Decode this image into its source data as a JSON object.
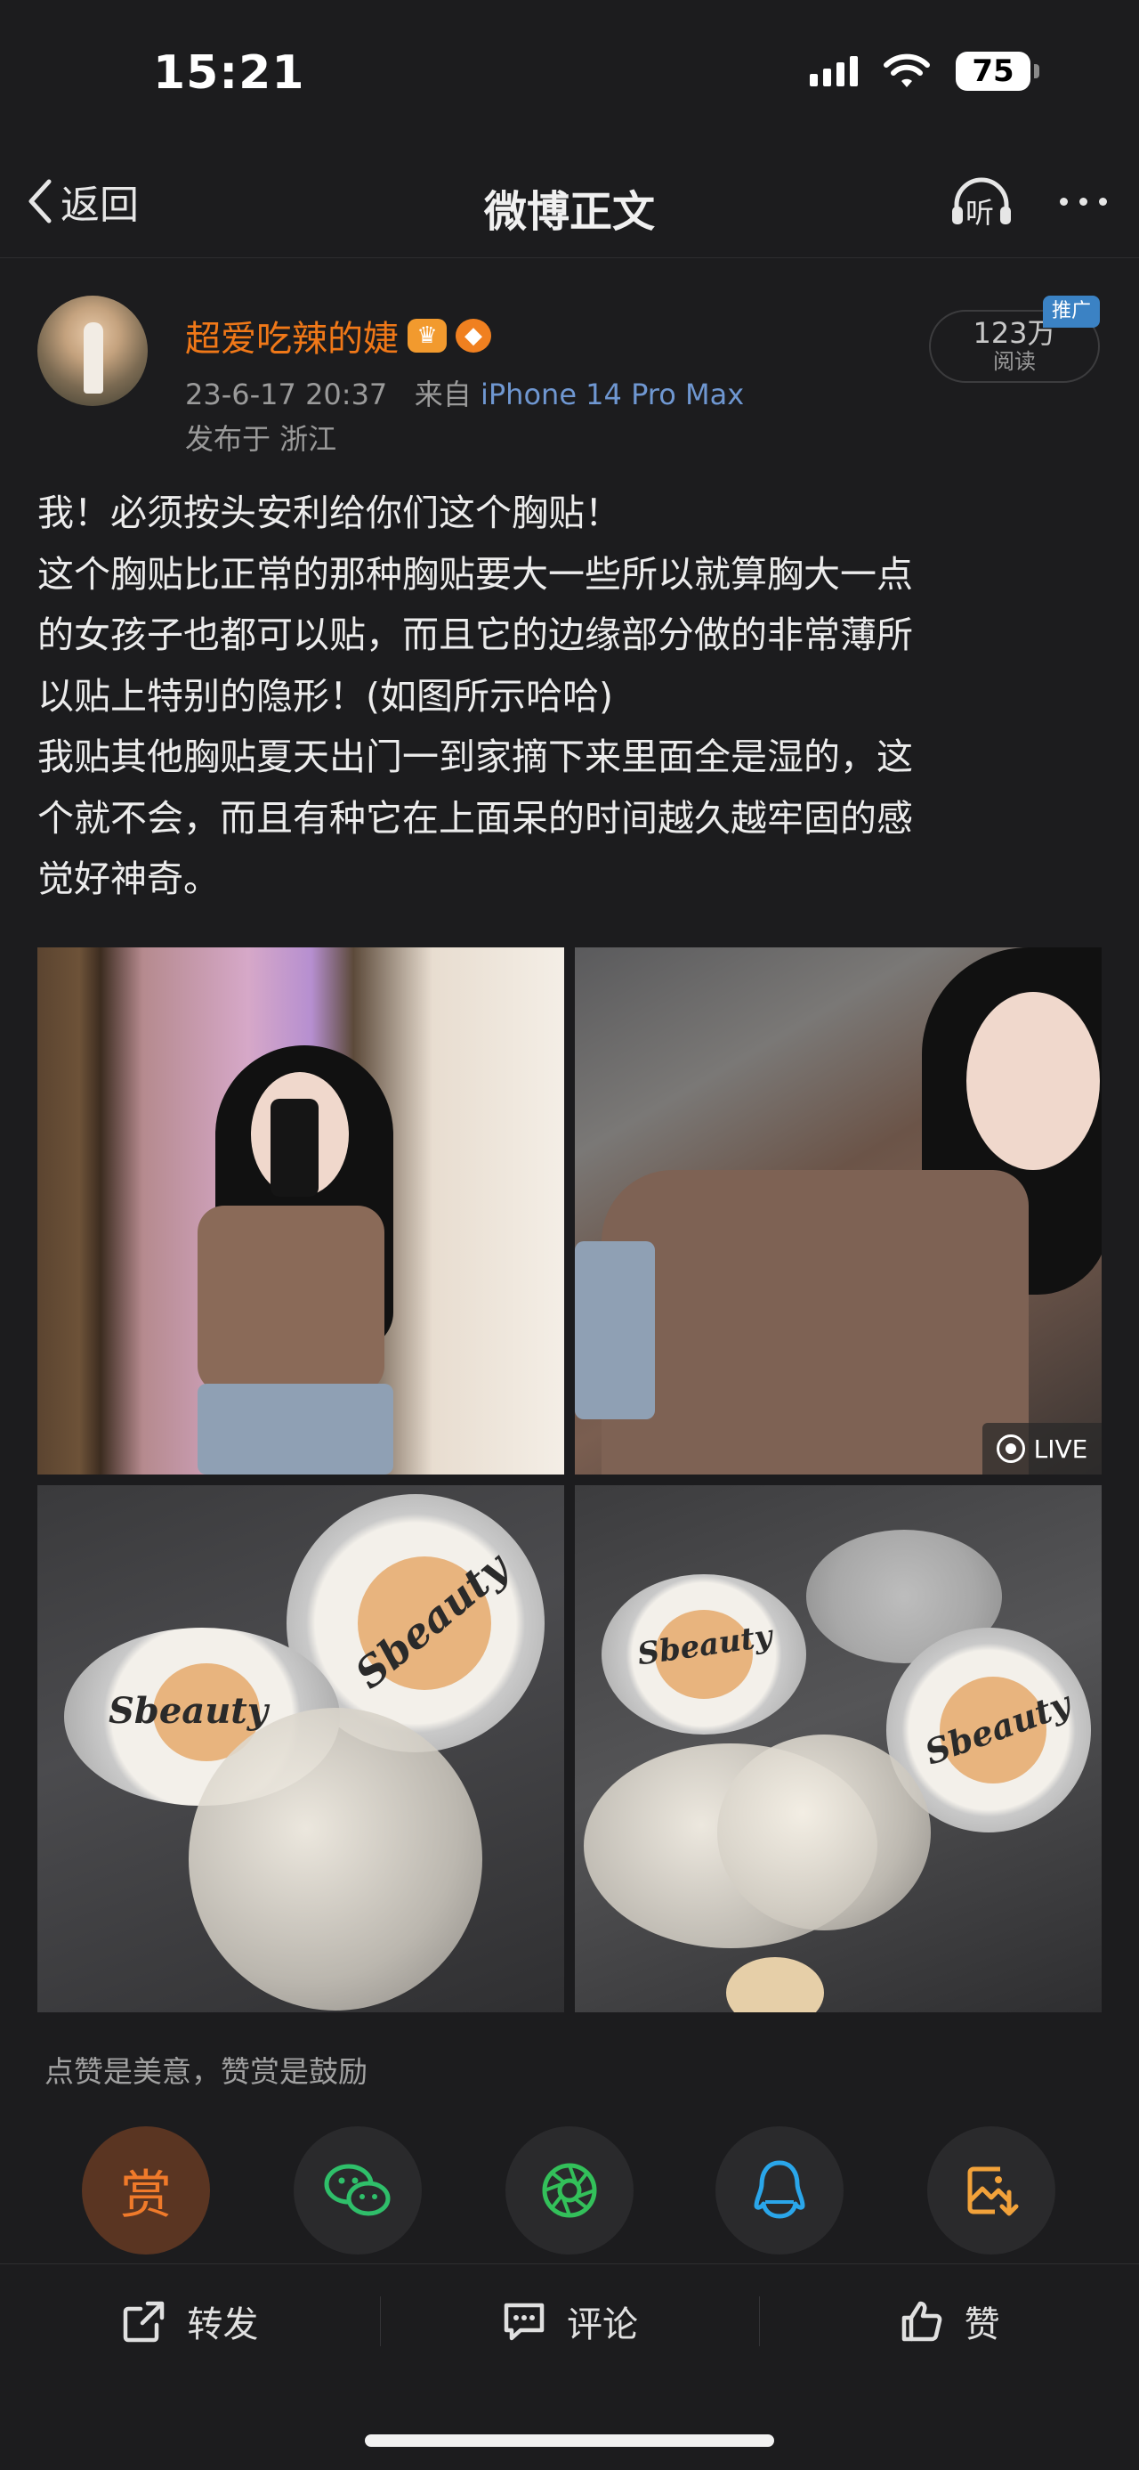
{
  "status_bar": {
    "time": "15:21",
    "battery": "75"
  },
  "nav": {
    "back_label": "返回",
    "title": "微博正文",
    "listen_label": "听"
  },
  "post": {
    "author": "超爱吃辣的婕",
    "date": "23-6-17 20:37",
    "source_prefix": "来自",
    "device": "iPhone 14 Pro Max",
    "location": "发布于 浙江",
    "read_count": "123万",
    "read_label": "阅读",
    "promo_label": "推广",
    "text_lines": [
      "我！必须按头安利给你们这个胸贴！",
      "这个胸贴比正常的那种胸贴要大一些所以就算胸大一点",
      "的女孩子也都可以贴，而且它的边缘部分做的非常薄所",
      "以贴上特别的隐形！(如图所示哈哈)",
      "我贴其他胸贴夏天出门一到家摘下来里面全是湿的，这",
      "个就不会，而且有种它在上面呆的时间越久越牢固的感",
      "觉好神奇。"
    ],
    "images": [
      {
        "name": "mirror-selfie-photo",
        "live": false
      },
      {
        "name": "closeup-selfie-photo",
        "live": true,
        "live_label": "LIVE"
      },
      {
        "name": "product-photo-1",
        "brand": "Sbeauty",
        "live": false
      },
      {
        "name": "product-photo-2",
        "brand": "Sbeauty",
        "live": false
      }
    ]
  },
  "share": {
    "hint": "点赞是美意，赞赏是鼓励",
    "reward_label": "赏",
    "targets": [
      "reward",
      "wechat",
      "moments",
      "qq",
      "save-image"
    ]
  },
  "toolbar": {
    "repost_label": "转发",
    "comment_label": "评论",
    "like_label": "赞"
  },
  "colors": {
    "background": "#1c1c1e",
    "username": "#f07818",
    "device_link": "#6f97d1",
    "promo": "#3b82c4"
  }
}
